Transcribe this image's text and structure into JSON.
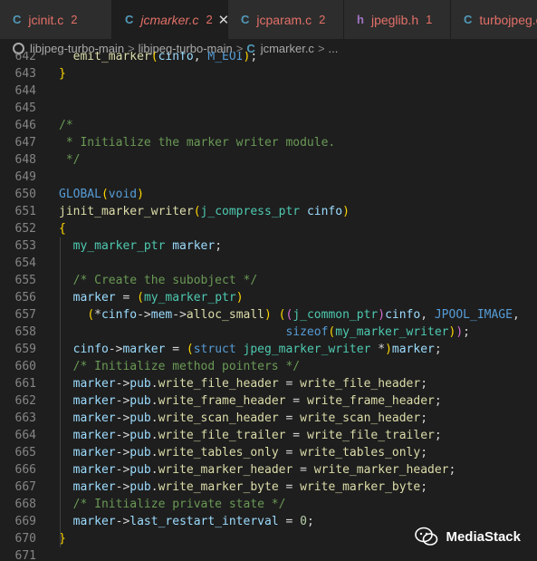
{
  "tabs": [
    {
      "lang": "C",
      "name": "jcinit.c",
      "badge": "2",
      "active": false
    },
    {
      "lang": "C",
      "name": "jcmarker.c",
      "badge": "2",
      "active": true,
      "close": "✕"
    },
    {
      "lang": "C",
      "name": "jcparam.c",
      "badge": "2",
      "active": false
    },
    {
      "lang": "h",
      "name": "jpeglib.h",
      "badge": "1",
      "active": false
    },
    {
      "lang": "C",
      "name": "turbojpeg.c",
      "badge": "",
      "active": false
    }
  ],
  "breadcrumb": {
    "items": [
      "libjpeg-turbo-main",
      "libjpeg-turbo-main",
      "jcmarker.c",
      "..."
    ],
    "sep": ">",
    "file_lang": "C"
  },
  "editor": {
    "lines": [
      {
        "n": "642",
        "text": "  emit_marker(cinfo, M_EOI);"
      },
      {
        "n": "643",
        "text": "}"
      },
      {
        "n": "644",
        "text": ""
      },
      {
        "n": "645",
        "text": ""
      },
      {
        "n": "646",
        "text": "/*"
      },
      {
        "n": "647",
        "text": " * Initialize the marker writer module."
      },
      {
        "n": "648",
        "text": " */"
      },
      {
        "n": "649",
        "text": ""
      },
      {
        "n": "650",
        "text": "GLOBAL(void)"
      },
      {
        "n": "651",
        "text": "jinit_marker_writer(j_compress_ptr cinfo)"
      },
      {
        "n": "652",
        "text": "{"
      },
      {
        "n": "653",
        "text": "  my_marker_ptr marker;"
      },
      {
        "n": "654",
        "text": ""
      },
      {
        "n": "655",
        "text": "  /* Create the subobject */"
      },
      {
        "n": "656",
        "text": "  marker = (my_marker_ptr)"
      },
      {
        "n": "657",
        "text": "    (*cinfo->mem->alloc_small) ((j_common_ptr)cinfo, JPOOL_IMAGE,"
      },
      {
        "n": "658",
        "text": "                                sizeof(my_marker_writer));"
      },
      {
        "n": "659",
        "text": "  cinfo->marker = (struct jpeg_marker_writer *)marker;"
      },
      {
        "n": "660",
        "text": "  /* Initialize method pointers */"
      },
      {
        "n": "661",
        "text": "  marker->pub.write_file_header = write_file_header;"
      },
      {
        "n": "662",
        "text": "  marker->pub.write_frame_header = write_frame_header;"
      },
      {
        "n": "663",
        "text": "  marker->pub.write_scan_header = write_scan_header;"
      },
      {
        "n": "664",
        "text": "  marker->pub.write_file_trailer = write_file_trailer;"
      },
      {
        "n": "665",
        "text": "  marker->pub.write_tables_only = write_tables_only;"
      },
      {
        "n": "666",
        "text": "  marker->pub.write_marker_header = write_marker_header;"
      },
      {
        "n": "667",
        "text": "  marker->pub.write_marker_byte = write_marker_byte;"
      },
      {
        "n": "668",
        "text": "  /* Initialize private state */"
      },
      {
        "n": "669",
        "text": "  marker->last_restart_interval = 0;"
      },
      {
        "n": "670",
        "text": "}"
      },
      {
        "n": "671",
        "text": ""
      }
    ]
  },
  "watermark": {
    "text": "MediaStack",
    "icon": "wechat-icon"
  },
  "colors": {
    "background": "#1e1e1e",
    "tab_error": "#e37068",
    "comment": "#6a9955",
    "keyword": "#569cd6",
    "type": "#4ec9b0",
    "function": "#dcdcaa",
    "variable": "#9cdcfe"
  }
}
